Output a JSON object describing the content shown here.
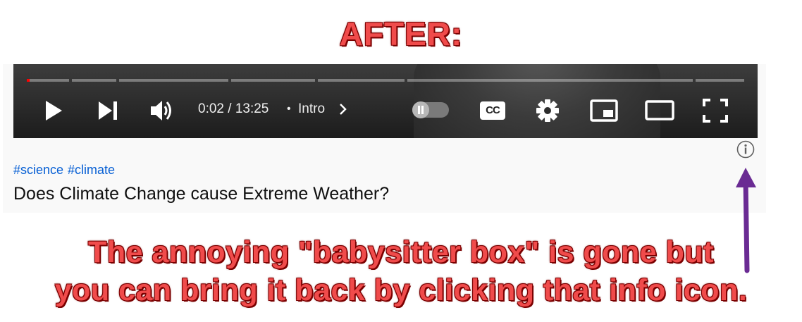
{
  "annotation": {
    "heading": "AFTER:",
    "caption_line1": "The annoying \"babysitter box\" is gone but",
    "caption_line2": "you can bring it back by clicking that info icon.",
    "text_color": "#f04b4b",
    "arrow_color": "#6a2b93"
  },
  "player": {
    "time_display": "0:02 / 13:25",
    "separator": "•",
    "chapter": "Intro",
    "cc_label": "CC",
    "progress_played_fraction": 0.0025,
    "icons": [
      "play-icon",
      "next-icon",
      "volume-icon",
      "chevron-right-icon",
      "autoplay-toggle",
      "cc-icon",
      "settings-icon",
      "miniplayer-icon",
      "theater-mode-icon",
      "fullscreen-icon"
    ]
  },
  "info_icon": {
    "name": "info-icon"
  },
  "video": {
    "hashtags": [
      "#science",
      "#climate"
    ],
    "title": "Does Climate Change cause Extreme Weather?"
  },
  "colors": {
    "accent_red": "#ff0000",
    "hashtag_blue": "#065fd4"
  }
}
